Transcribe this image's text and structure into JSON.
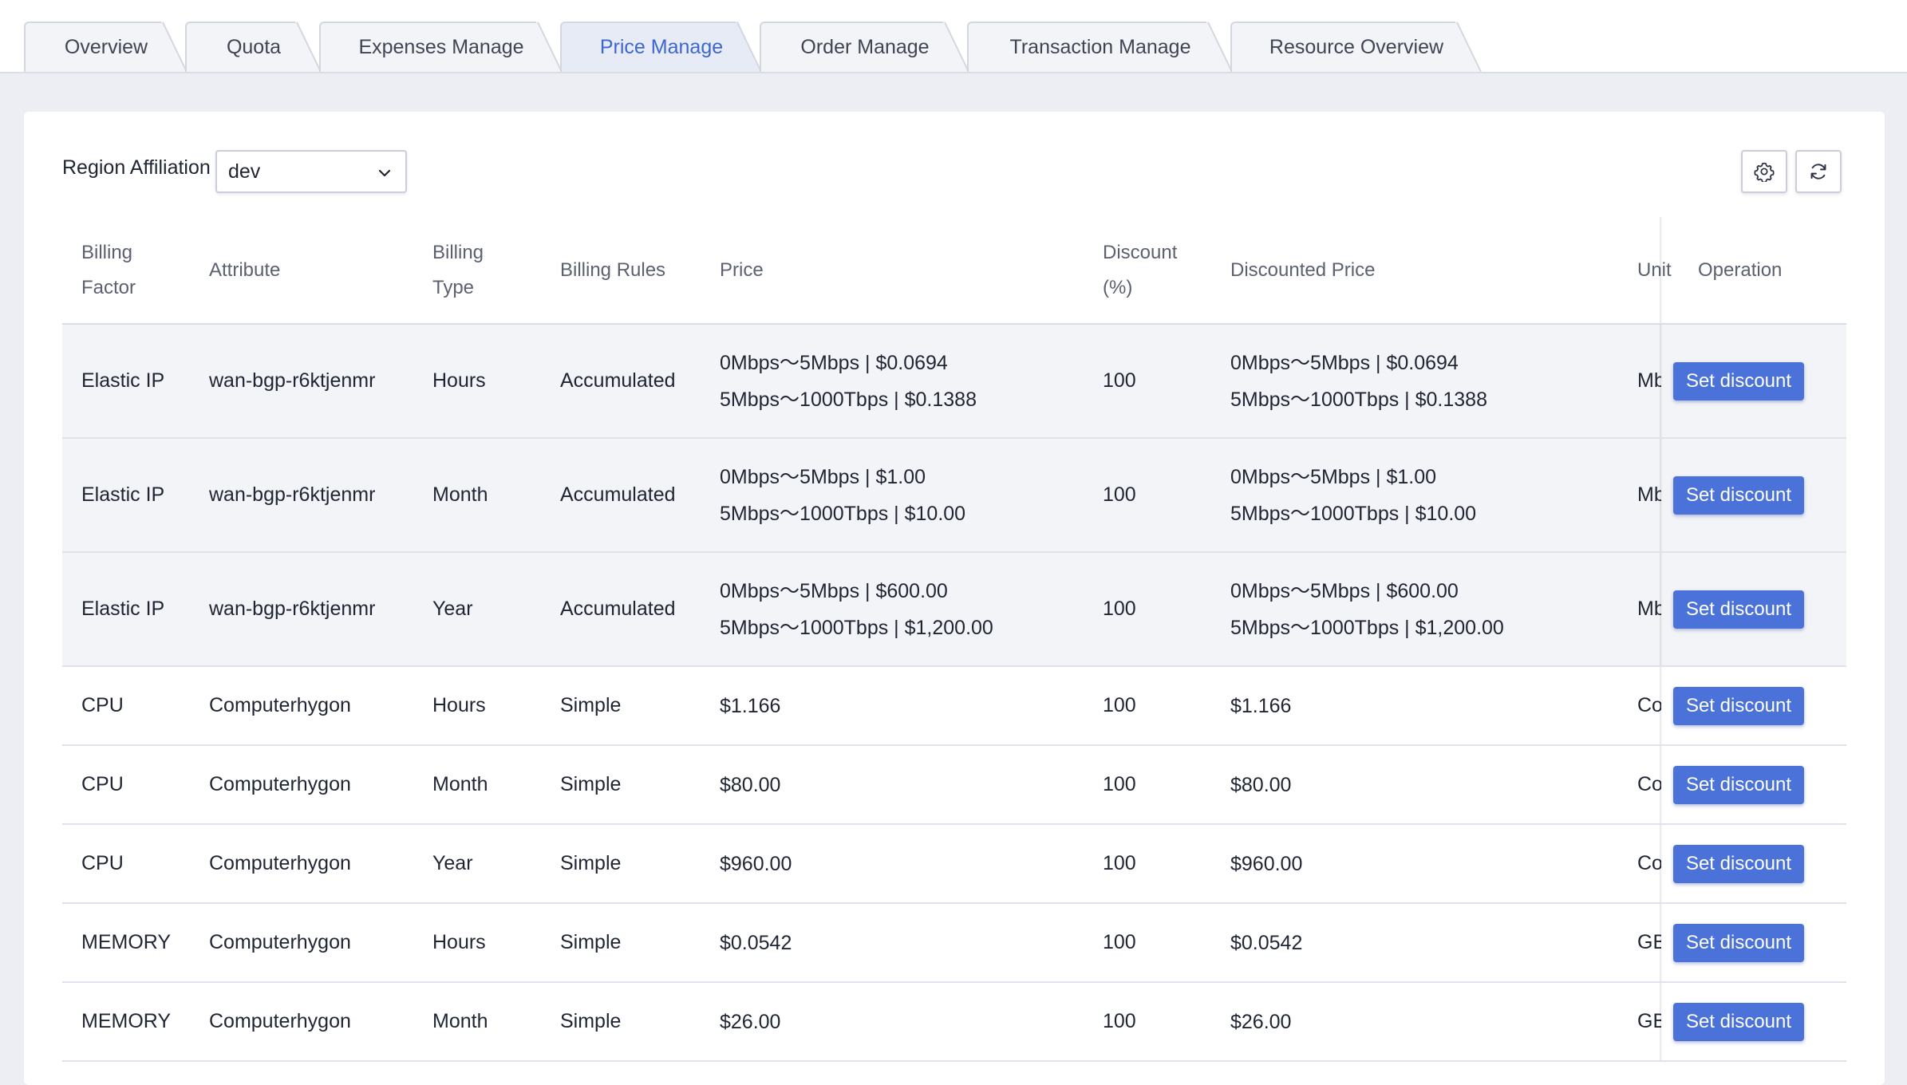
{
  "tabs": [
    {
      "label": "Overview",
      "active": false
    },
    {
      "label": "Quota",
      "active": false
    },
    {
      "label": "Expenses Manage",
      "active": false
    },
    {
      "label": "Price Manage",
      "active": true
    },
    {
      "label": "Order Manage",
      "active": false
    },
    {
      "label": "Transaction Manage",
      "active": false
    },
    {
      "label": "Resource Overview",
      "active": false
    }
  ],
  "filter": {
    "region_label": "Region Affiliation",
    "region_value": "dev"
  },
  "toolbar": {
    "settings_icon": "gear-icon",
    "refresh_icon": "refresh-icon"
  },
  "table": {
    "headers": {
      "billing_factor": [
        "Billing",
        "Factor"
      ],
      "attribute": "Attribute",
      "billing_type": [
        "Billing",
        "Type"
      ],
      "billing_rules": "Billing Rules",
      "price": "Price",
      "discount": [
        "Discount",
        "(%)"
      ],
      "discounted_price": "Discounted Price",
      "unit": "Unit",
      "operation": "Operation"
    },
    "action_label": "Set discount",
    "rows": [
      {
        "factor": "Elastic IP",
        "attribute": "wan-bgp-r6ktjenmr",
        "type": "Hours",
        "rules": "Accumulated",
        "price": [
          "0Mbps～5Mbps | $0.0694",
          "5Mbps～1000Tbps | $0.1388"
        ],
        "discount": "100",
        "discounted": [
          "0Mbps～5Mbps | $0.0694",
          "5Mbps～1000Tbps | $0.1388"
        ],
        "unit": "Mbp"
      },
      {
        "factor": "Elastic IP",
        "attribute": "wan-bgp-r6ktjenmr",
        "type": "Month",
        "rules": "Accumulated",
        "price": [
          "0Mbps～5Mbps | $1.00",
          "5Mbps～1000Tbps | $10.00"
        ],
        "discount": "100",
        "discounted": [
          "0Mbps～5Mbps | $1.00",
          "5Mbps～1000Tbps | $10.00"
        ],
        "unit": "Mbp"
      },
      {
        "factor": "Elastic IP",
        "attribute": "wan-bgp-r6ktjenmr",
        "type": "Year",
        "rules": "Accumulated",
        "price": [
          "0Mbps～5Mbps | $600.00",
          "5Mbps～1000Tbps | $1,200.00"
        ],
        "discount": "100",
        "discounted": [
          "0Mbps～5Mbps | $600.00",
          "5Mbps～1000Tbps | $1,200.00"
        ],
        "unit": "Mbp"
      },
      {
        "factor": "CPU",
        "attribute": "Computerhygon",
        "type": "Hours",
        "rules": "Simple",
        "price": [
          "$1.166"
        ],
        "discount": "100",
        "discounted": [
          "$1.166"
        ],
        "unit": "Core"
      },
      {
        "factor": "CPU",
        "attribute": "Computerhygon",
        "type": "Month",
        "rules": "Simple",
        "price": [
          "$80.00"
        ],
        "discount": "100",
        "discounted": [
          "$80.00"
        ],
        "unit": "Core"
      },
      {
        "factor": "CPU",
        "attribute": "Computerhygon",
        "type": "Year",
        "rules": "Simple",
        "price": [
          "$960.00"
        ],
        "discount": "100",
        "discounted": [
          "$960.00"
        ],
        "unit": "Core"
      },
      {
        "factor": "MEMORY",
        "attribute": "Computerhygon",
        "type": "Hours",
        "rules": "Simple",
        "price": [
          "$0.0542"
        ],
        "discount": "100",
        "discounted": [
          "$0.0542"
        ],
        "unit": "GB"
      },
      {
        "factor": "MEMORY",
        "attribute": "Computerhygon",
        "type": "Month",
        "rules": "Simple",
        "price": [
          "$26.00"
        ],
        "discount": "100",
        "discounted": [
          "$26.00"
        ],
        "unit": "GB"
      }
    ]
  },
  "colors": {
    "accent": "#4a72d8",
    "active_tab_text": "#3d66cf",
    "page_bg": "#eceef4"
  }
}
